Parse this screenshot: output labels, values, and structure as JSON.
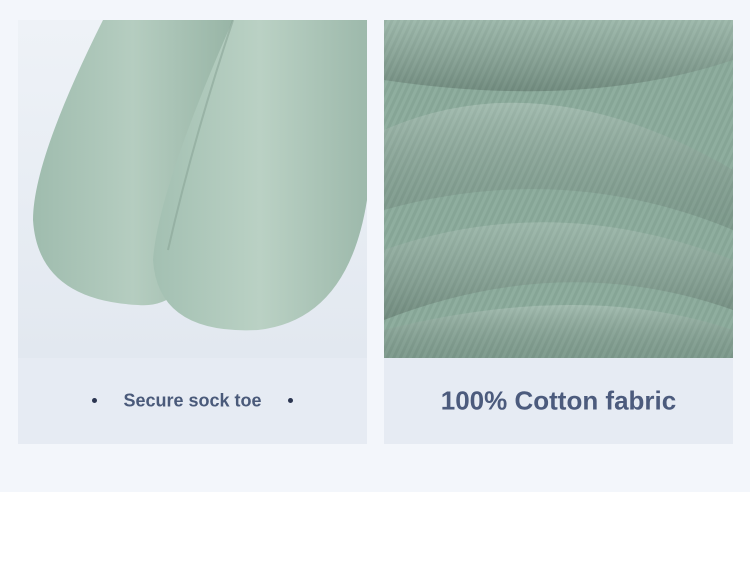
{
  "panels": [
    {
      "caption": "Secure sock toe",
      "image_subject": "green-sock-toes"
    },
    {
      "caption": "100% Cotton fabric",
      "image_subject": "green-cotton-fabric-closeup"
    }
  ],
  "colors": {
    "band_background": "#f3f6fb",
    "caption_background": "#e6ebf3",
    "caption_text": "#4a5a7a",
    "sock_green": "#a7c1b4",
    "fabric_green": "#8fae9f"
  }
}
